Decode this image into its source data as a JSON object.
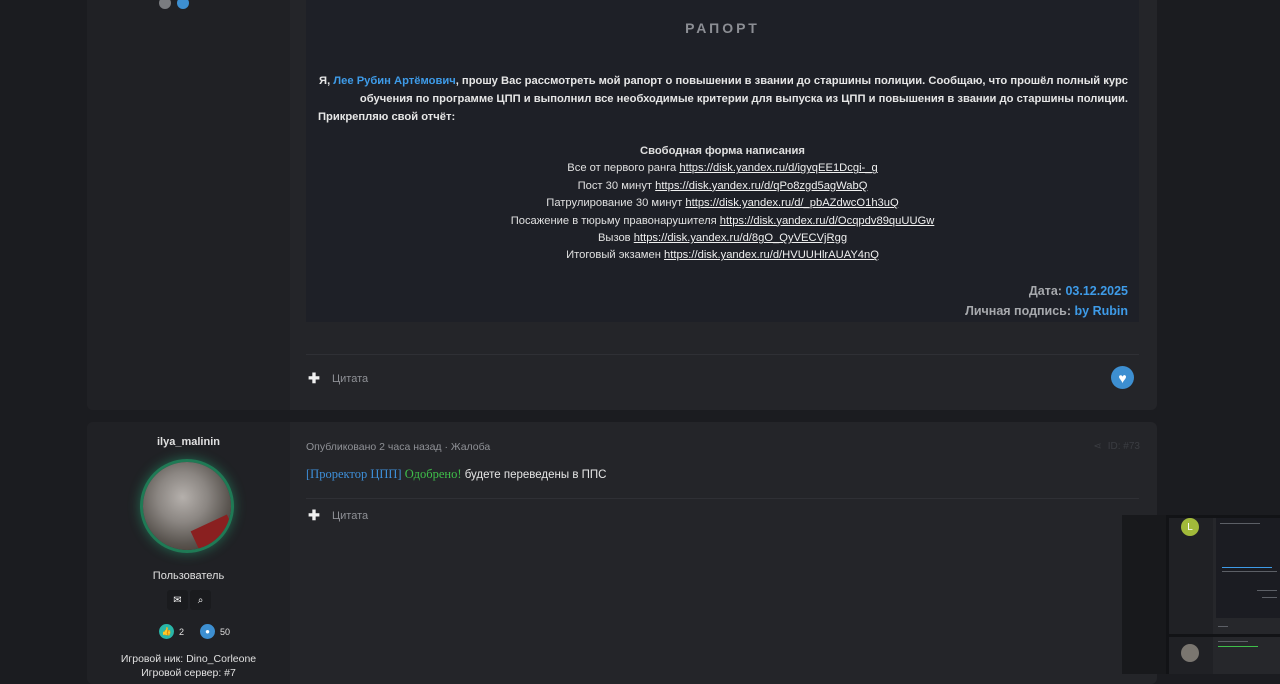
{
  "post1": {
    "raport_title": "РАПОРТ",
    "intro_before_name": "Я, ",
    "intro_name": "Лее Рубин Артёмович",
    "intro_after_name": ", прошу Вас рассмотреть мой рапорт о повышении в звании до старшины полиции. Сообщаю, что прошёл полный курс обучения по программе ЦПП и выполнил все необходимые критерии для выпуска из ЦПП и повышения в звании до старшины полиции.",
    "intro_last": "Прикрепляю свой отчёт:",
    "free_form_title": "Свободная форма написания",
    "reports": [
      {
        "label": "Все от первого ранга",
        "link": "https://disk.yandex.ru/d/igyqEE1Dcgi-_g"
      },
      {
        "label": "Пост 30 минут",
        "link": "https://disk.yandex.ru/d/qPo8zgd5agWabQ"
      },
      {
        "label": "Патрулирование 30 минут",
        "link": "https://disk.yandex.ru/d/_pbAZdwcO1h3uQ"
      },
      {
        "label": "Посажение в тюрьму правонарушителя",
        "link": "https://disk.yandex.ru/d/Ocqpdv89quUUGw"
      },
      {
        "label": "Вызов",
        "link": "https://disk.yandex.ru/d/8gO_QyVECVjRgg"
      },
      {
        "label": "Итоговый экзамен",
        "link": "https://disk.yandex.ru/d/HVUUHlrAUAY4nQ"
      }
    ],
    "date_label": "Дата:",
    "date_value": "03.12.2025",
    "signature_label": "Личная подпись:",
    "signature_value": "by Rubin",
    "quote_label": "Цитата"
  },
  "post2": {
    "username": "ilya_malinin",
    "role": "Пользователь",
    "likes": "2",
    "messages": "50",
    "nick": "Игровой ник: Dino_Corleone",
    "server": "Игровой сервер: #7",
    "meta_published": "Опубликовано 2 часа назад",
    "meta_sep": " · ",
    "meta_complaint": "Жалоба",
    "post_id": "ID: #73",
    "message_prefix": "[Проректор ЦПП]",
    "message_ok": "Одобрено!",
    "message_text": "будете переведены в ППС",
    "quote_label": "Цитата"
  },
  "thumbnail": {
    "avatar_letter": "L"
  },
  "colors": {
    "accent_blue": "#3e9be8",
    "approve_green": "#3fbf4a",
    "avatar_glow": "#28be82"
  }
}
